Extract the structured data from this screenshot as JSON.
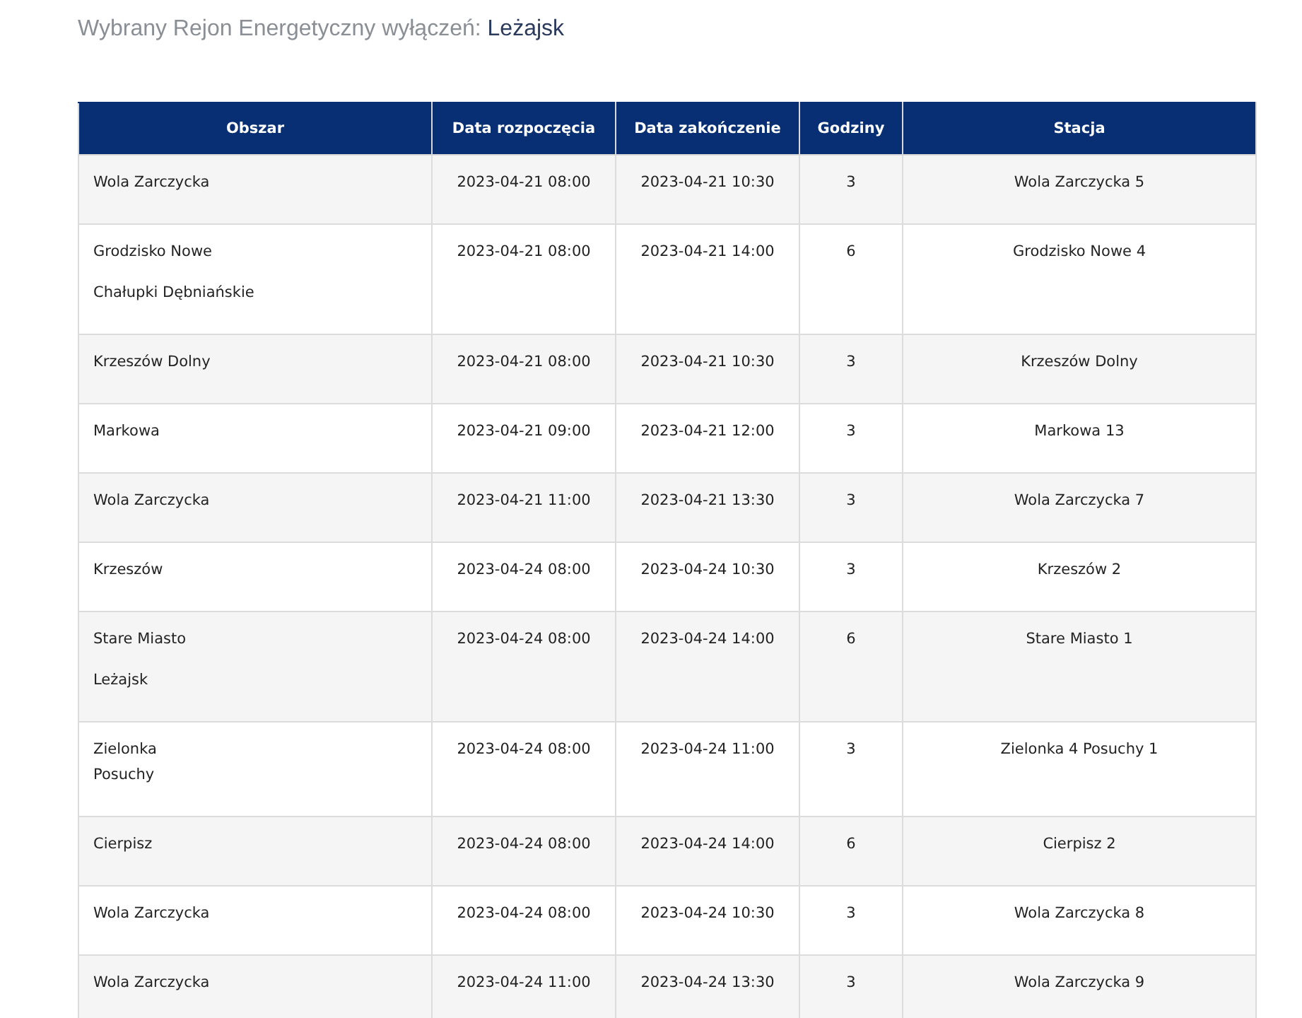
{
  "heading": {
    "label": "Wybrany Rejon Energetyczny wyłączeń:",
    "value": "Leżajsk"
  },
  "table": {
    "columns": [
      "Obszar",
      "Data rozpoczęcia",
      "Data zakończenie",
      "Godziny",
      "Stacja"
    ],
    "rows": [
      {
        "area": [
          {
            "text": "Wola Zarczycka",
            "kind": "paragraph"
          }
        ],
        "start": "2023-04-21 08:00",
        "end": "2023-04-21 10:30",
        "hours": "3",
        "station": "Wola Zarczycka 5"
      },
      {
        "area": [
          {
            "text": "Grodzisko Nowe",
            "kind": "paragraph"
          },
          {
            "text": "Chałupki Dębniańskie",
            "kind": "paragraph"
          }
        ],
        "start": "2023-04-21 08:00",
        "end": "2023-04-21 14:00",
        "hours": "6",
        "station": "Grodzisko Nowe 4"
      },
      {
        "area": [
          {
            "text": "Krzeszów Dolny",
            "kind": "paragraph"
          }
        ],
        "start": "2023-04-21 08:00",
        "end": "2023-04-21 10:30",
        "hours": "3",
        "station": "Krzeszów Dolny"
      },
      {
        "area": [
          {
            "text": "Markowa",
            "kind": "paragraph"
          }
        ],
        "start": "2023-04-21 09:00",
        "end": "2023-04-21 12:00",
        "hours": "3",
        "station": "Markowa 13"
      },
      {
        "area": [
          {
            "text": "Wola Zarczycka",
            "kind": "paragraph"
          }
        ],
        "start": "2023-04-21 11:00",
        "end": "2023-04-21 13:30",
        "hours": "3",
        "station": "Wola Zarczycka 7"
      },
      {
        "area": [
          {
            "text": "Krzeszów",
            "kind": "paragraph"
          }
        ],
        "start": "2023-04-24 08:00",
        "end": "2023-04-24 10:30",
        "hours": "3",
        "station": "Krzeszów 2"
      },
      {
        "area": [
          {
            "text": "Stare Miasto",
            "kind": "paragraph"
          },
          {
            "text": "Leżajsk",
            "kind": "paragraph"
          }
        ],
        "start": "2023-04-24 08:00",
        "end": "2023-04-24 14:00",
        "hours": "6",
        "station": "Stare Miasto 1"
      },
      {
        "area": [
          {
            "text": "Zielonka",
            "kind": "line"
          },
          {
            "text": "Posuchy",
            "kind": "indented"
          }
        ],
        "start": "2023-04-24 08:00",
        "end": "2023-04-24 11:00",
        "hours": "3",
        "station": "Zielonka 4 Posuchy 1"
      },
      {
        "area": [
          {
            "text": "Cierpisz",
            "kind": "paragraph"
          }
        ],
        "start": "2023-04-24 08:00",
        "end": "2023-04-24 14:00",
        "hours": "6",
        "station": "Cierpisz 2"
      },
      {
        "area": [
          {
            "text": "Wola Zarczycka",
            "kind": "paragraph"
          }
        ],
        "start": "2023-04-24 08:00",
        "end": "2023-04-24 10:30",
        "hours": "3",
        "station": "Wola Zarczycka 8"
      },
      {
        "area": [
          {
            "text": "Wola Zarczycka",
            "kind": "paragraph"
          }
        ],
        "start": "2023-04-24 11:00",
        "end": "2023-04-24 13:30",
        "hours": "3",
        "station": "Wola Zarczycka 9"
      }
    ]
  }
}
